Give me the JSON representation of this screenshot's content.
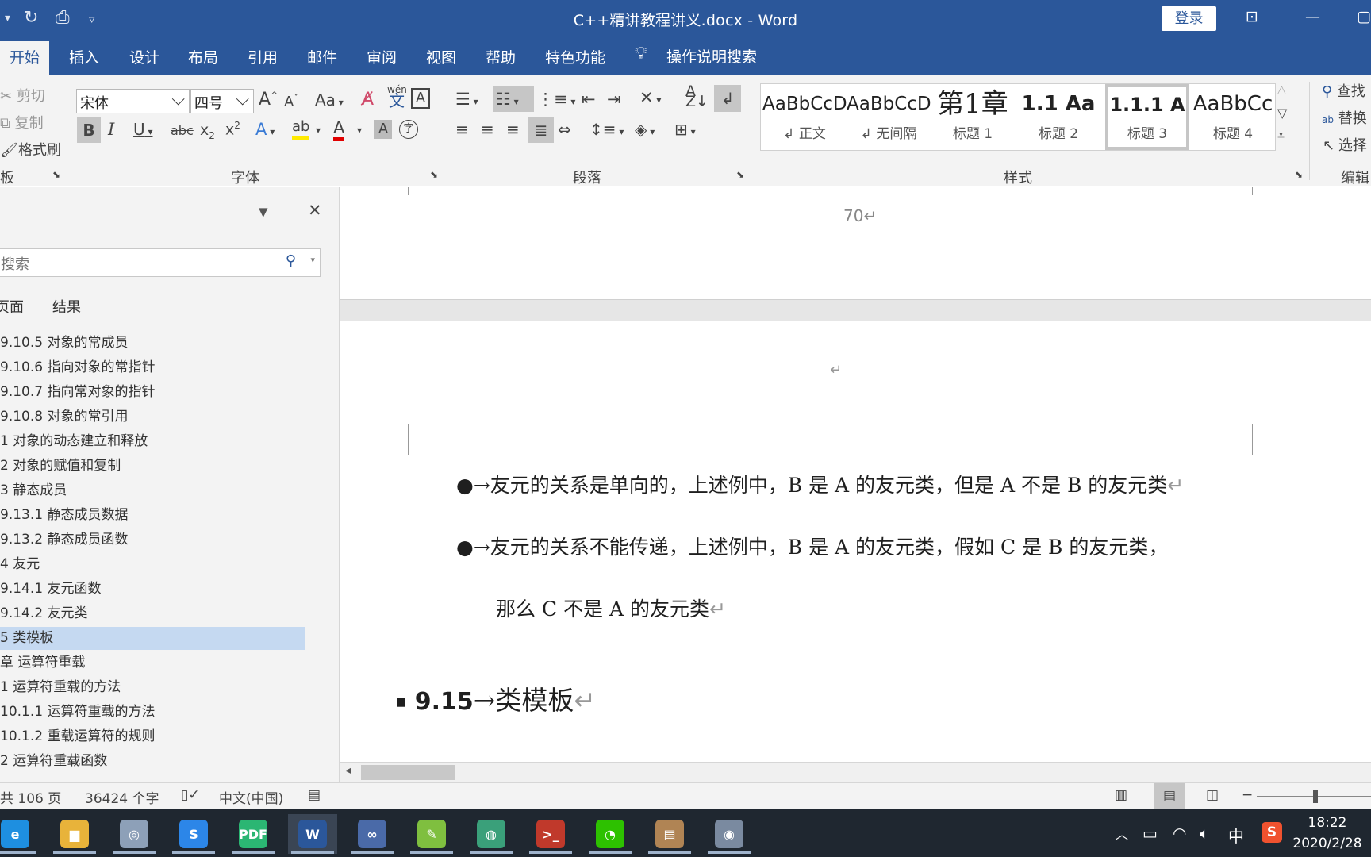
{
  "titlebar": {
    "doc_title": "C++精讲教程讲义.docx  -  Word",
    "login": "登录"
  },
  "tabs": [
    "开始",
    "插入",
    "设计",
    "布局",
    "引用",
    "邮件",
    "审阅",
    "视图",
    "帮助",
    "特色功能"
  ],
  "tell_me": "操作说明搜索",
  "ribbon": {
    "clipboard": {
      "cut": "剪切",
      "copy": "复制",
      "format_painter": "格式刷",
      "label_partial": "板"
    },
    "font": {
      "name": "宋体",
      "size": "四号",
      "label": "字体",
      "grow": "A",
      "shrink": "A",
      "case": "Aa",
      "phonetic": "wén",
      "phonetic_char": "文"
    },
    "paragraph": {
      "label": "段落"
    },
    "styles": {
      "label": "样式",
      "items": [
        {
          "preview": "AaBbCcD",
          "name": "↲ 正文"
        },
        {
          "preview": "AaBbCcD",
          "name": "↲ 无间隔"
        },
        {
          "preview": "第1章",
          "name": "标题 1"
        },
        {
          "preview": "1.1  Aa",
          "name": "标题 2"
        },
        {
          "preview": "1.1.1  A",
          "name": "标题 3"
        },
        {
          "preview": "AaBbCc",
          "name": "标题 4"
        }
      ]
    },
    "editing": {
      "find": "查找",
      "replace": "替换",
      "select": "选择",
      "label": "编辑"
    }
  },
  "nav": {
    "search_placeholder": "搜索",
    "tabs": [
      "页面",
      "结果"
    ],
    "headings": [
      "9.10.5 对象的常成员",
      "9.10.6 指向对象的常指针",
      "9.10.7 指向常对象的指针",
      "9.10.8 对象的常引用",
      "1 对象的动态建立和释放",
      "2 对象的赋值和复制",
      "3 静态成员",
      "9.13.1 静态成员数据",
      "9.13.2 静态成员函数",
      "4 友元",
      "9.14.1 友元函数",
      "9.14.2 友元类",
      "5 类模板",
      "章 运算符重载",
      "1 运算符重载的方法",
      "10.1.1 运算符重载的方法",
      "10.1.2 重载运算符的规则",
      "2 运算符重载函数"
    ],
    "selected_index": 12
  },
  "document": {
    "page_number": "70",
    "bullet1": "友元的关系是单向的，上述例中，B 是 A 的友元类，但是 A 不是 B 的友元类",
    "bullet2_line1": "友元的关系不能传递，上述例中，B 是 A 的友元类，假如 C 是 B 的友元类，",
    "bullet2_line2": "那么 C 不是 A 的友元类",
    "heading_num": "9.15",
    "heading_text": "类模板",
    "para_mark": "↵",
    "tab_arrow": "→",
    "bullet": "●"
  },
  "status": {
    "pages": "共 106 页",
    "words": "36424 个字",
    "language": "中文(中国)"
  },
  "taskbar": {
    "apps": [
      {
        "name": "edge",
        "label": "e",
        "color": "#1e8fe0"
      },
      {
        "name": "explorer",
        "label": "▆",
        "color": "#e8b33a"
      },
      {
        "name": "vm",
        "label": "◎",
        "color": "#8da0b8"
      },
      {
        "name": "sogou-browser",
        "label": "S",
        "color": "#2c86e8"
      },
      {
        "name": "pdf",
        "label": "PDF",
        "color": "#2bb673"
      },
      {
        "name": "word",
        "label": "W",
        "color": "#2b579a"
      },
      {
        "name": "infinity",
        "label": "∞",
        "color": "#4a6aa8"
      },
      {
        "name": "notepad",
        "label": "✎",
        "color": "#7fbf3f"
      },
      {
        "name": "globe",
        "label": "◍",
        "color": "#3aa07a"
      },
      {
        "name": "terminal",
        "label": ">_",
        "color": "#c0392b"
      },
      {
        "name": "wechat",
        "label": "◔",
        "color": "#2dc100"
      },
      {
        "name": "archive",
        "label": "▤",
        "color": "#b08454"
      },
      {
        "name": "camera",
        "label": "◉",
        "color": "#7a8aa0"
      }
    ],
    "ime": "中",
    "time": "18:22",
    "date": "2020/2/28"
  },
  "colors": {
    "word_blue": "#2b579a",
    "selection": "#c5d9f1"
  }
}
